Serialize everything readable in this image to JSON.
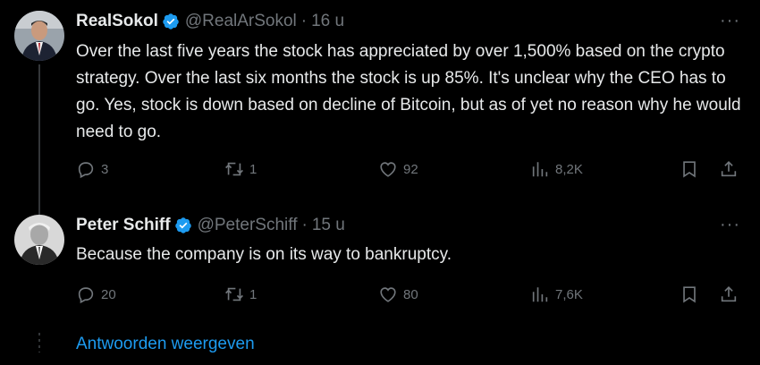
{
  "tweets": [
    {
      "name": "RealSokol",
      "handle": "@RealArSokol",
      "time": "16 u",
      "separator": "·",
      "more": "···",
      "text": "Over the last five years the stock has appreciated by over 1,500% based on the crypto strategy.  Over the last six months the stock is up 85%.  It's unclear why the CEO has to go.  Yes, stock is down based on decline of Bitcoin, but as of yet no reason why he would need to go.",
      "replies": "3",
      "retweets": "1",
      "likes": "92",
      "views": "8,2K"
    },
    {
      "name": "Peter Schiff",
      "handle": "@PeterSchiff",
      "time": "15 u",
      "separator": "·",
      "more": "···",
      "text": "Because the company is on its way to bankruptcy.",
      "replies": "20",
      "retweets": "1",
      "likes": "80",
      "views": "7,6K"
    }
  ],
  "show_replies": "Antwoorden weergeven",
  "colors": {
    "background": "#000000",
    "text": "#e7e9ea",
    "muted": "#71767b",
    "accent": "#1d9bf0"
  },
  "icons": [
    "verified-badge-icon",
    "more-icon",
    "reply-icon",
    "retweet-icon",
    "like-icon",
    "views-icon",
    "bookmark-icon",
    "share-icon"
  ]
}
